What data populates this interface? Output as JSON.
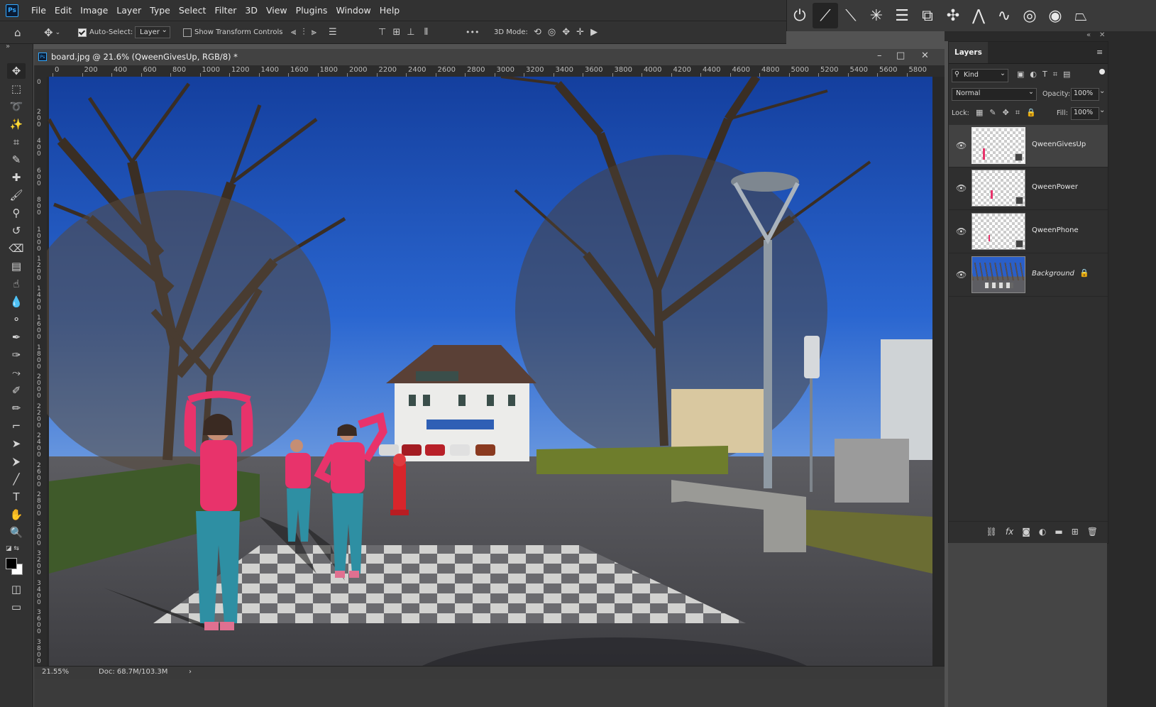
{
  "app": {
    "logo_text": "Ps"
  },
  "menu": [
    "File",
    "Edit",
    "Image",
    "Layer",
    "Type",
    "Select",
    "Filter",
    "3D",
    "View",
    "Plugins",
    "Window",
    "Help"
  ],
  "options_bar": {
    "auto_select_label": "Auto-Select:",
    "auto_select_target": "Layer",
    "show_transform_label": "Show Transform Controls",
    "more_label": "•••",
    "mode_3d_label": "3D Mode:"
  },
  "document": {
    "title": "board.jpg @ 21.6% (QweenGivesUp, RGB/8) *",
    "icon_text": "Ps",
    "ruler_h": [
      "0",
      "200",
      "400",
      "600",
      "800",
      "1000",
      "1200",
      "1400",
      "1600",
      "1800",
      "2000",
      "2200",
      "2400",
      "2600",
      "2800",
      "3000",
      "3200",
      "3400",
      "3600",
      "3800",
      "4000",
      "4200",
      "4400",
      "4600",
      "4800",
      "5000",
      "5200",
      "5400",
      "5600",
      "5800"
    ],
    "ruler_v": [
      "0",
      "200",
      "400",
      "600",
      "800",
      "1000",
      "1200",
      "1400",
      "1600",
      "1800",
      "2000",
      "2200",
      "2400",
      "2600",
      "2800",
      "3000",
      "3200",
      "3400",
      "3600",
      "3800"
    ]
  },
  "status": {
    "zoom": "21.55%",
    "doc_size": "Doc: 68.7M/103.3M",
    "arrow": "›"
  },
  "layers_panel": {
    "tab_label": "Layers",
    "filter_kind": "Kind",
    "blend_mode": "Normal",
    "opacity_label": "Opacity:",
    "opacity_value": "100%",
    "lock_label": "Lock:",
    "fill_label": "Fill:",
    "fill_value": "100%",
    "layers": [
      {
        "name": "QweenGivesUp"
      },
      {
        "name": "QweenPower"
      },
      {
        "name": "QweenPhone"
      },
      {
        "name": "Background"
      }
    ]
  },
  "colors": {
    "accent": "#31a8ff",
    "panel_bg": "#2f2f2f",
    "sky": "#1f56c8",
    "shirt": "#e8336b",
    "pants": "#2e8fa3"
  }
}
